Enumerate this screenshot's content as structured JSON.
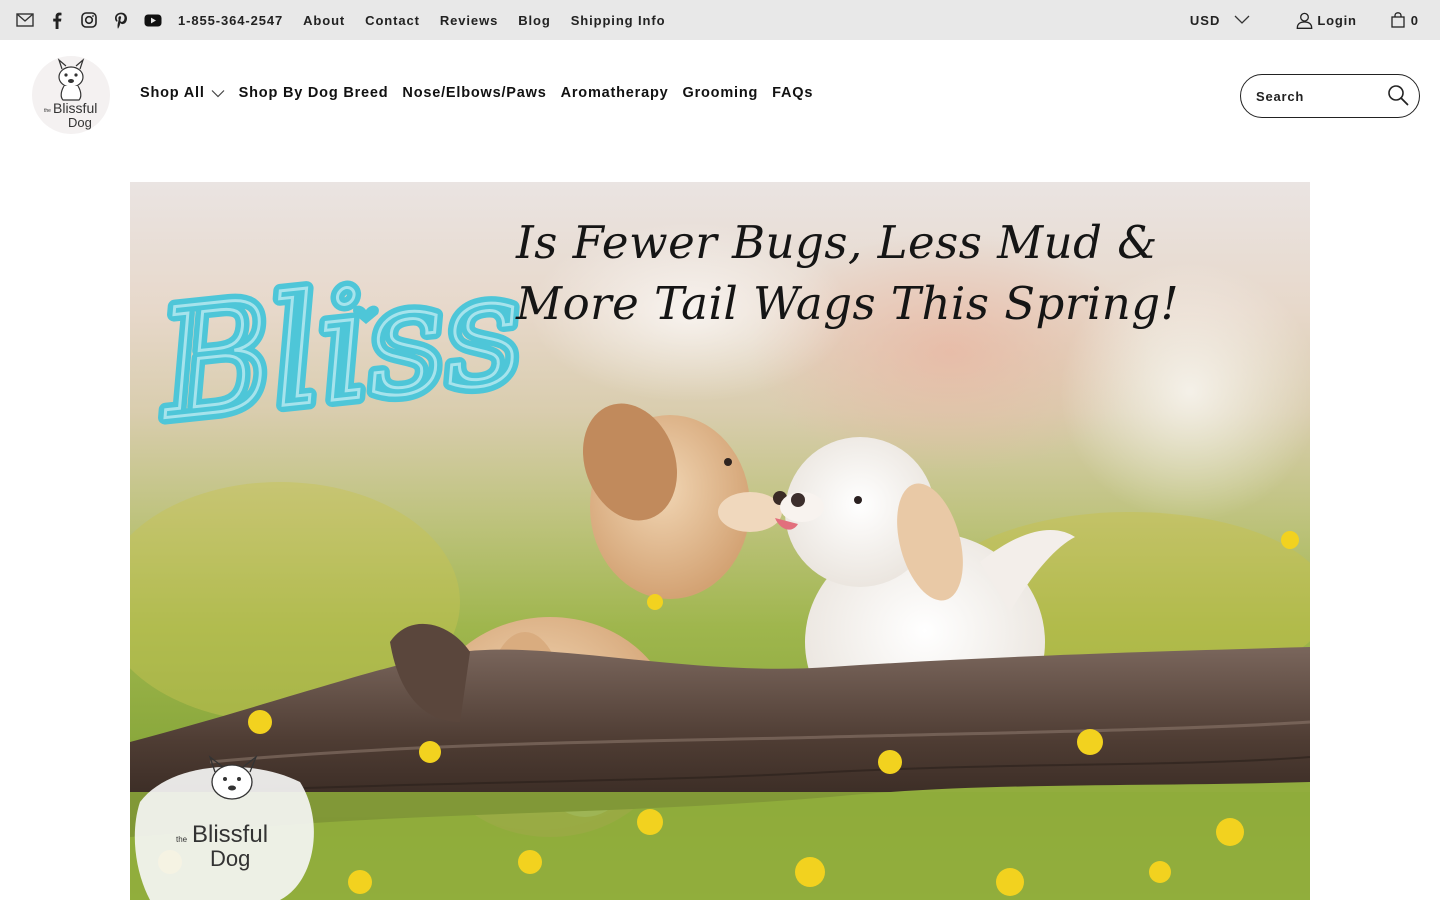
{
  "topbar": {
    "social_icons": [
      "mail-icon",
      "facebook-icon",
      "instagram-icon",
      "pinterest-icon",
      "youtube-icon"
    ],
    "phone": "1-855-364-2547",
    "links": [
      "About",
      "Contact",
      "Reviews",
      "Blog",
      "Shipping Info"
    ],
    "currency": "USD",
    "login_label": "Login",
    "cart_count": "0"
  },
  "header": {
    "logo_text": "the Blissful Dog",
    "nav": [
      "Shop All",
      "Shop By Dog Breed",
      "Nose/Elbows/Paws",
      "Aromatherapy",
      "Grooming",
      "FAQs"
    ],
    "search_placeholder": "Search"
  },
  "hero": {
    "script_word": "Bliss",
    "headline_line1": "Is Fewer Bugs, Less Mud &",
    "headline_line2": "More Tail Wags This Spring!",
    "badge_logo_text": "the Blissful Dog"
  },
  "colors": {
    "topbar_bg": "#e8e8e8",
    "bliss_teal": "#4ec6d8",
    "text": "#111111"
  }
}
